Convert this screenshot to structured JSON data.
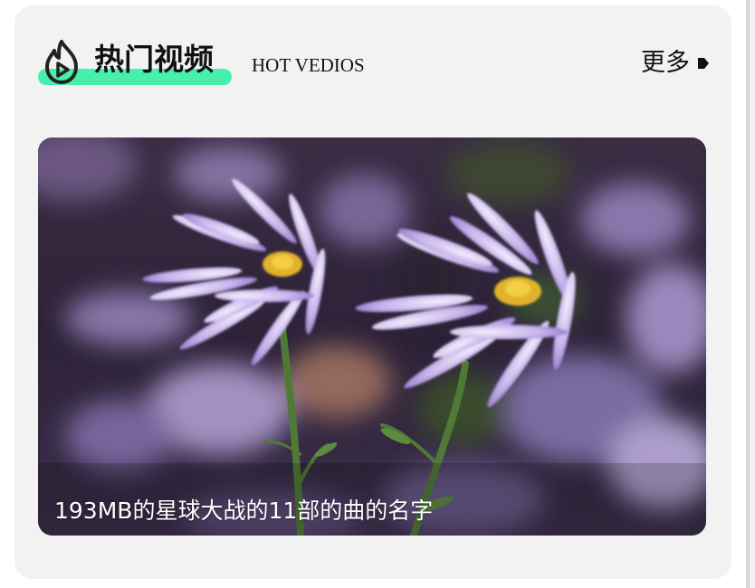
{
  "section": {
    "title": "热门视频",
    "subtitle": "HOT VEDIOS",
    "more_label": "更多",
    "icon": "fire-play-icon",
    "more_icon": "arrow-right-icon"
  },
  "video": {
    "caption": "193MB的星球大战的11部的曲的名字",
    "thumbnail": "purple-aster-flowers-image"
  },
  "colors": {
    "card_background": "#f2f2f2",
    "title_highlight": "#46f0ac",
    "text": "#111111",
    "caption_text": "#ffffff"
  }
}
